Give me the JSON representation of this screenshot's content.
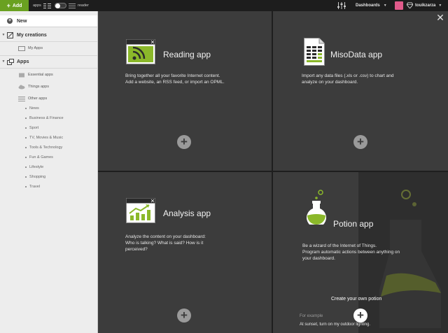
{
  "topbar": {
    "add_label": "Add",
    "mode_apps": "apps",
    "mode_reader": "reader",
    "dashboards_label": "Dashboards",
    "username": "touikzarza"
  },
  "sidebar": {
    "new_label": "New",
    "my_creations_label": "My creations",
    "my_apps_label": "My Apps",
    "apps_label": "Apps",
    "essential_apps": "Essential apps",
    "things_apps": "Things apps",
    "other_apps": "Other apps",
    "categories": [
      "News",
      "Business & Finance",
      "Sport",
      "TV, Movies & Music",
      "Tools & Technology",
      "Fun & Games",
      "Lifestyle",
      "Shopping",
      "Travel"
    ]
  },
  "tiles": {
    "reading": {
      "title": "Reading app",
      "desc1": "Bring together all your favorite Internet content.",
      "desc2": "Add a website, an RSS feed, or import an OPML."
    },
    "misodata": {
      "title": "MisoData app",
      "desc1": "Import any data files (.xls or .csv) to chart and",
      "desc2": "analyze on your dashboard."
    },
    "analysis": {
      "title": "Analysis app",
      "desc1": "Analyze the content on your dashboard:",
      "desc2": "Who is talking? What is said? How is it",
      "desc3": "perceived?"
    },
    "potion": {
      "title": "Potion app",
      "desc1": "Be a wizard of the Internet of Things.",
      "desc2": "Program automatic actions between anything on",
      "desc3": "your dashboard.",
      "create_label": "Create your own potion",
      "example_label": "For example",
      "example_text": "At sunset, turn on my outdoor lighting."
    }
  },
  "colors": {
    "accent": "#6aa121",
    "tile_bg": "#3c3c3c",
    "sidebar_bg": "#ededed",
    "topbar_bg": "#1d1d1d"
  }
}
